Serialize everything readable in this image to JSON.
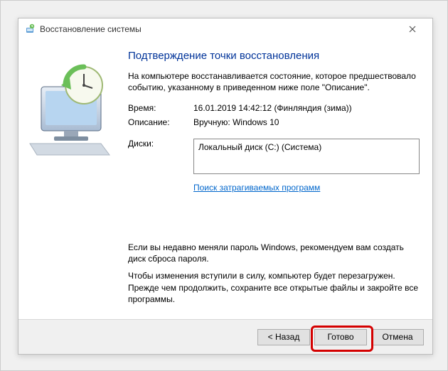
{
  "window": {
    "title": "Восстановление системы"
  },
  "content": {
    "heading": "Подтверждение точки восстановления",
    "intro": "На компьютере восстанавливается состояние, которое предшествовало событию, указанному в приведенном ниже поле \"Описание\".",
    "time_label": "Время:",
    "time_value": "16.01.2019 14:42:12 (Финляндия (зима))",
    "desc_label": "Описание:",
    "desc_value": "Вручную: Windows 10",
    "disks_label": "Диски:",
    "disks_value": "Локальный диск (C:) (Система)",
    "scan_link": "Поиск затрагиваемых программ",
    "note1": "Если вы недавно меняли пароль Windows, рекомендуем вам создать диск сброса пароля.",
    "note2": "Чтобы изменения вступили в силу, компьютер будет перезагружен. Прежде чем продолжить, сохраните все открытые файлы и закройте все программы."
  },
  "footer": {
    "back": "< Назад",
    "finish": "Готово",
    "cancel": "Отмена"
  }
}
